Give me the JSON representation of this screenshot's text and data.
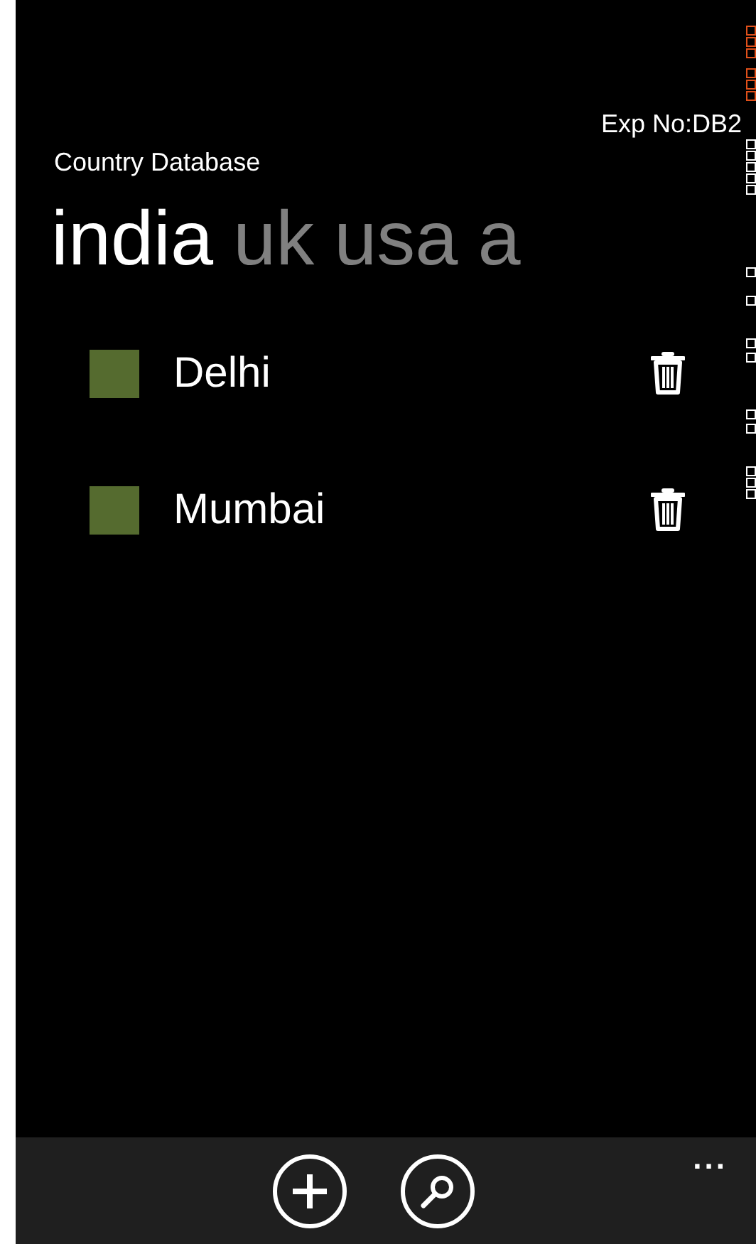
{
  "header": {
    "experiment": "Exp No:DB2",
    "app_title": "Country Database"
  },
  "pivot": [
    {
      "label": "india",
      "selected": true
    },
    {
      "label": "uk",
      "selected": false
    },
    {
      "label": "usa",
      "selected": false
    },
    {
      "label": "a",
      "selected": false
    }
  ],
  "cities": [
    {
      "name": "Delhi"
    },
    {
      "name": "Mumbai"
    }
  ],
  "app_bar": {
    "more": "..."
  }
}
